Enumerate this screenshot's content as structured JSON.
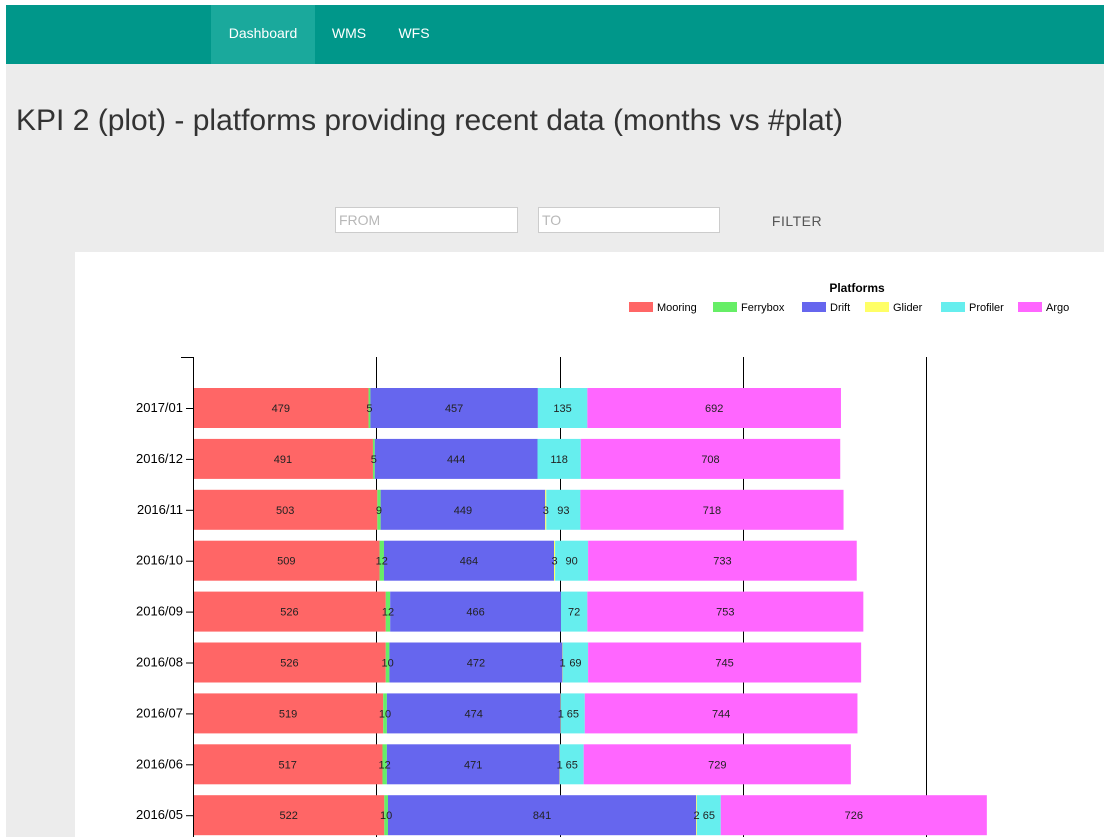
{
  "navbar": {
    "items": [
      {
        "label": "Dashboard",
        "active": true
      },
      {
        "label": "WMS",
        "active": false
      },
      {
        "label": "WFS",
        "active": false
      }
    ],
    "background": "#00978a"
  },
  "page": {
    "title": "KPI 2 (plot) - platforms providing recent data (months vs #plat)"
  },
  "filter": {
    "from_placeholder": "FROM",
    "to_placeholder": "TO",
    "button_label": "FILTER"
  },
  "chart_data": {
    "type": "bar",
    "orientation": "horizontal",
    "stacked": true,
    "legend_title": "Platforms",
    "legend_position": "top-right",
    "grid": true,
    "categories": [
      "2017/01",
      "2016/12",
      "2016/11",
      "2016/10",
      "2016/09",
      "2016/08",
      "2016/07",
      "2016/06",
      "2016/05"
    ],
    "series": [
      {
        "name": "Mooring",
        "color": "#ff6666",
        "values": [
          479,
          491,
          503,
          509,
          526,
          526,
          519,
          517,
          522
        ]
      },
      {
        "name": "Ferrybox",
        "color": "#66ee66",
        "values": [
          5,
          5,
          9,
          12,
          12,
          10,
          10,
          12,
          10
        ]
      },
      {
        "name": "Drift",
        "color": "#6666ee",
        "values": [
          457,
          444,
          449,
          464,
          466,
          472,
          474,
          471,
          841
        ]
      },
      {
        "name": "Glider",
        "color": "#ffff66",
        "values": [
          0,
          0,
          3,
          3,
          0,
          1,
          1,
          1,
          2
        ]
      },
      {
        "name": "Profiler",
        "color": "#66eeee",
        "values": [
          135,
          118,
          93,
          90,
          72,
          69,
          65,
          65,
          65
        ]
      },
      {
        "name": "Argo",
        "color": "#ff66ff",
        "values": [
          692,
          708,
          718,
          733,
          753,
          745,
          744,
          729,
          726
        ]
      }
    ],
    "xlim": [
      0,
      2500
    ]
  }
}
